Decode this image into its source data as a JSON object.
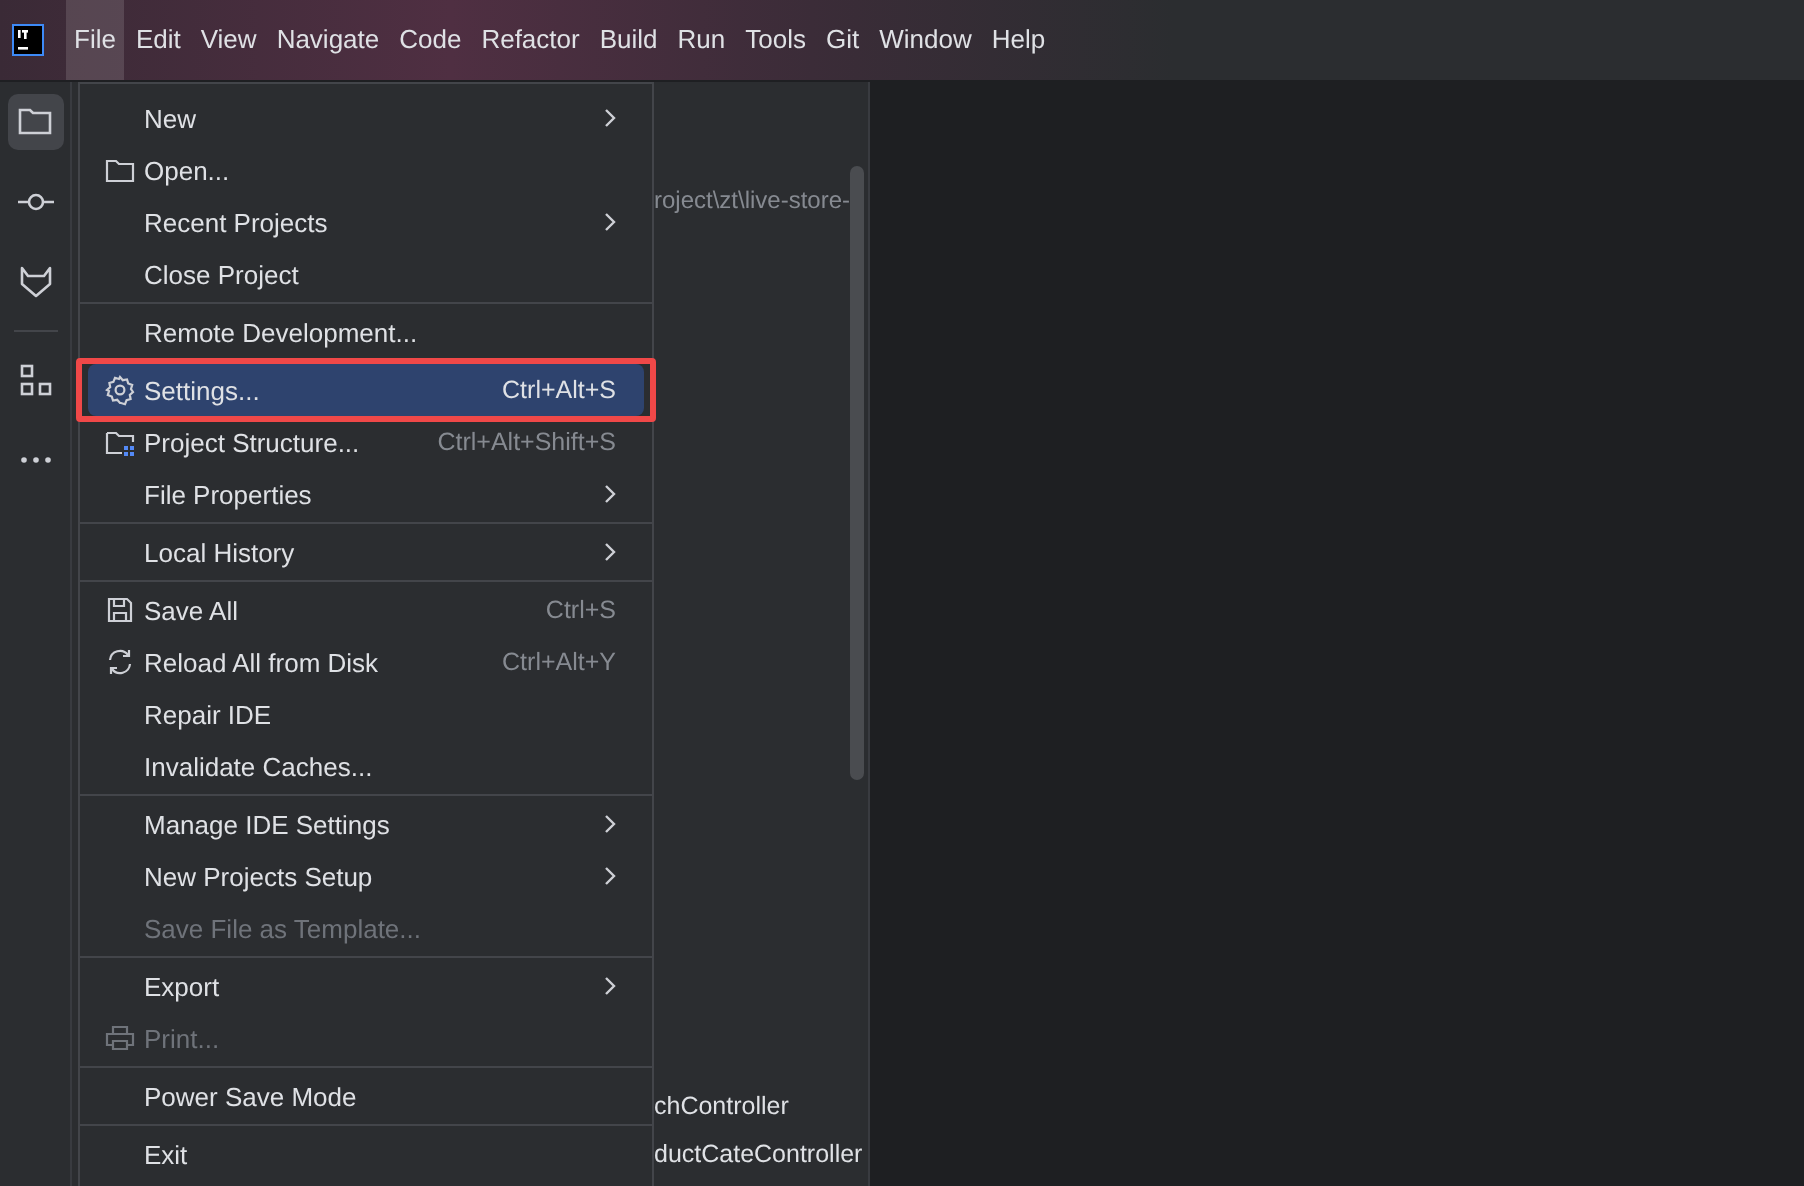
{
  "menubar": [
    {
      "label": "File",
      "selected": true
    },
    {
      "label": "Edit",
      "selected": false
    },
    {
      "label": "View",
      "selected": false
    },
    {
      "label": "Navigate",
      "selected": false
    },
    {
      "label": "Code",
      "selected": false
    },
    {
      "label": "Refactor",
      "selected": false
    },
    {
      "label": "Build",
      "selected": false
    },
    {
      "label": "Run",
      "selected": false
    },
    {
      "label": "Tools",
      "selected": false
    },
    {
      "label": "Git",
      "selected": false
    },
    {
      "label": "Window",
      "selected": false
    },
    {
      "label": "Help",
      "selected": false
    }
  ],
  "toolbar": [
    {
      "kind": "folder",
      "selected": true
    },
    {
      "kind": "commit",
      "selected": false
    },
    {
      "kind": "fox",
      "selected": false
    },
    {
      "kind": "separator"
    },
    {
      "kind": "structure",
      "selected": false
    },
    {
      "kind": "more",
      "selected": false
    }
  ],
  "project_panel": {
    "path": "roject\\zt\\live-store-",
    "items": [
      "chController",
      "ductCateController"
    ]
  },
  "file_menu": [
    {
      "kind": "plain",
      "label": "New",
      "submenu": true
    },
    {
      "kind": "folder",
      "label": "Open..."
    },
    {
      "kind": "plain",
      "label": "Recent Projects",
      "submenu": true
    },
    {
      "kind": "plain",
      "label": "Close Project"
    },
    {
      "kind": "separator"
    },
    {
      "kind": "plain",
      "label": "Remote Development..."
    },
    {
      "kind": "separator"
    },
    {
      "kind": "gear",
      "label": "Settings...",
      "shortcut": "Ctrl+Alt+S",
      "selected": true,
      "outlined": true
    },
    {
      "kind": "structure",
      "label": "Project Structure...",
      "shortcut": "Ctrl+Alt+Shift+S"
    },
    {
      "kind": "plain",
      "label": "File Properties",
      "submenu": true
    },
    {
      "kind": "separator"
    },
    {
      "kind": "plain",
      "label": "Local History",
      "submenu": true
    },
    {
      "kind": "separator"
    },
    {
      "kind": "save",
      "label": "Save All",
      "shortcut": "Ctrl+S"
    },
    {
      "kind": "reload",
      "label": "Reload All from Disk",
      "shortcut": "Ctrl+Alt+Y"
    },
    {
      "kind": "plain",
      "label": "Repair IDE"
    },
    {
      "kind": "plain",
      "label": "Invalidate Caches..."
    },
    {
      "kind": "separator"
    },
    {
      "kind": "plain",
      "label": "Manage IDE Settings",
      "submenu": true
    },
    {
      "kind": "plain",
      "label": "New Projects Setup",
      "submenu": true
    },
    {
      "kind": "plain",
      "label": "Save File as Template...",
      "disabled": true
    },
    {
      "kind": "separator"
    },
    {
      "kind": "plain",
      "label": "Export",
      "submenu": true
    },
    {
      "kind": "printer",
      "label": "Print...",
      "disabled": true
    },
    {
      "kind": "separator"
    },
    {
      "kind": "plain",
      "label": "Power Save Mode"
    },
    {
      "kind": "separator"
    },
    {
      "kind": "plain",
      "label": "Exit"
    }
  ]
}
